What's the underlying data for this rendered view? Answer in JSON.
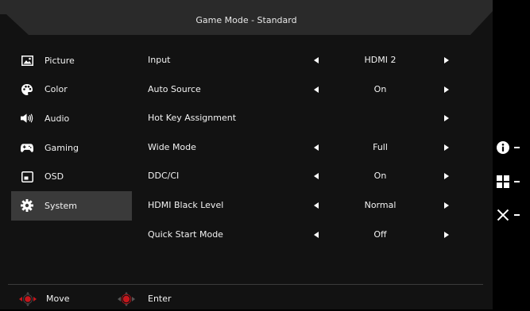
{
  "title": "Game Mode - Standard",
  "sidebar": {
    "items": [
      {
        "label": "Picture",
        "icon": "picture-icon",
        "active": false
      },
      {
        "label": "Color",
        "icon": "palette-icon",
        "active": false
      },
      {
        "label": "Audio",
        "icon": "speaker-icon",
        "active": false
      },
      {
        "label": "Gaming",
        "icon": "gamepad-icon",
        "active": false
      },
      {
        "label": "OSD",
        "icon": "osd-window-icon",
        "active": false
      },
      {
        "label": "System",
        "icon": "gear-icon",
        "active": true
      }
    ]
  },
  "settings": {
    "rows": [
      {
        "label": "Input",
        "value": "HDMI 2",
        "left_arrow": true,
        "right_arrow": true
      },
      {
        "label": "Auto Source",
        "value": "On",
        "left_arrow": true,
        "right_arrow": true
      },
      {
        "label": "Hot Key Assignment",
        "value": "",
        "left_arrow": false,
        "right_arrow": true
      },
      {
        "label": "Wide Mode",
        "value": "Full",
        "left_arrow": true,
        "right_arrow": true
      },
      {
        "label": "DDC/CI",
        "value": "On",
        "left_arrow": true,
        "right_arrow": true
      },
      {
        "label": "HDMI Black Level",
        "value": "Normal",
        "left_arrow": true,
        "right_arrow": true
      },
      {
        "label": "Quick Start Mode",
        "value": "Off",
        "left_arrow": true,
        "right_arrow": true
      }
    ]
  },
  "footer": {
    "move_label": "Move",
    "enter_label": "Enter",
    "move_icon": "joystick-horizontal-icon",
    "enter_icon": "joystick-press-icon",
    "accent": "#c4161c"
  },
  "keys": [
    {
      "icon": "info-icon"
    },
    {
      "icon": "menu-grid-icon"
    },
    {
      "icon": "close-icon"
    }
  ],
  "colors": {
    "panel": "#121212",
    "title_bar": "#2a2a2a",
    "active_item": "#3a3a3a",
    "text": "#f2f2f2"
  }
}
